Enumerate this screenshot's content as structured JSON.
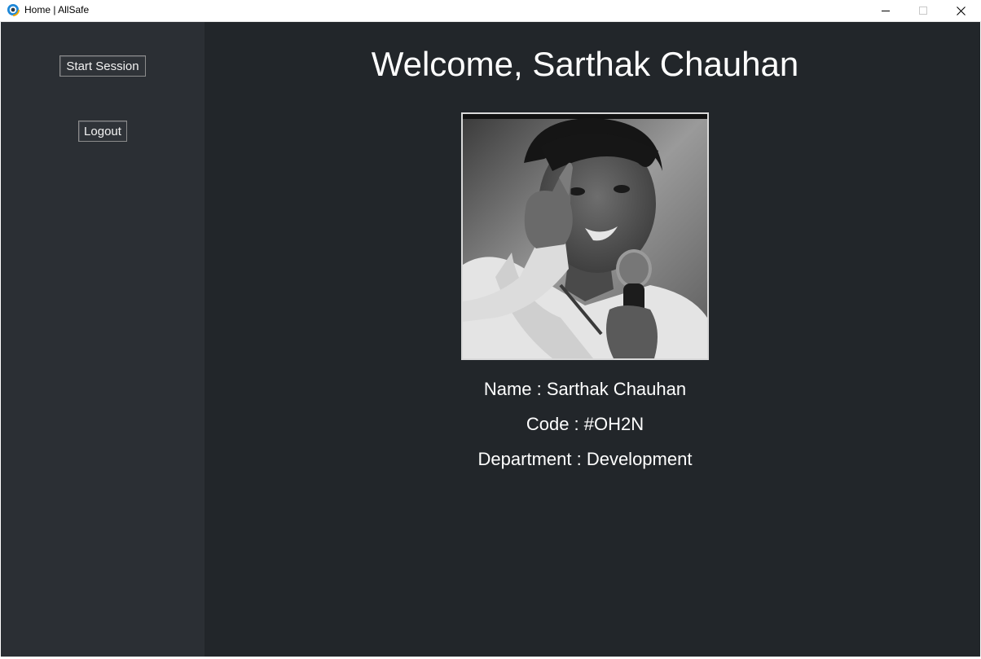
{
  "window": {
    "title": "Home | AllSafe",
    "icon": "allsafe-app-icon",
    "controls": [
      "minimize-icon",
      "maximize-icon",
      "close-icon"
    ]
  },
  "sidebar": {
    "start_session_label": "Start Session",
    "logout_label": "Logout"
  },
  "main": {
    "welcome": "Welcome, Sarthak Chauhan",
    "photo": "profile-photo",
    "name_line": "Name : Sarthak Chauhan",
    "code_line": "Code : #OH2N",
    "department_line": "Department : Development"
  },
  "colors": {
    "sidebar_bg": "#2b2f34",
    "main_bg": "#22262a",
    "text": "#ffffff"
  }
}
